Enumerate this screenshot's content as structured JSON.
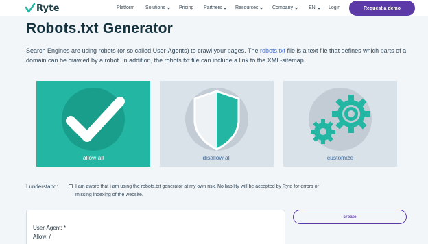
{
  "header": {
    "logo_text": "Ryte",
    "nav": [
      {
        "label": "Platform",
        "dropdown": false
      },
      {
        "label": "Solutions",
        "dropdown": true
      },
      {
        "label": "Pricing",
        "dropdown": false
      },
      {
        "label": "Partners",
        "dropdown": true
      },
      {
        "label": "Resources",
        "dropdown": true
      },
      {
        "label": "Company",
        "dropdown": true
      },
      {
        "label": "EN",
        "dropdown": true
      },
      {
        "label": "Login",
        "dropdown": false
      }
    ],
    "cta_label": "Request a demo"
  },
  "page": {
    "title": "Robots.txt Generator",
    "intro_part1": "Search Engines are using robots (or so called User-Agents) to crawl your pages. The ",
    "intro_link": "robots.txt",
    "intro_part2": " file is a text file that defines which parts of a domain can be crawled by a robot. In addition, the robots.txt file can include a link to the XML-sitemap."
  },
  "options": [
    {
      "label": "allow all",
      "icon": "checkmark-icon",
      "selected": true
    },
    {
      "label": "disallow all",
      "icon": "shield-icon",
      "selected": false
    },
    {
      "label": "customize",
      "icon": "gears-icon",
      "selected": false
    }
  ],
  "consent": {
    "label": "I understand:",
    "checked": false,
    "text": "I am aware that i am using the robots.txt generator at my own risk. No liability will be accepted by Ryte for errors or missing indexing of the website."
  },
  "output": {
    "line1": "User-Agent: *",
    "line2": "Allow: /"
  },
  "create_label": "create",
  "colors": {
    "teal": "#23b7a3",
    "purple": "#5b3aa8",
    "card_gray": "#d9e1e9",
    "link_blue": "#4a6fd0"
  }
}
